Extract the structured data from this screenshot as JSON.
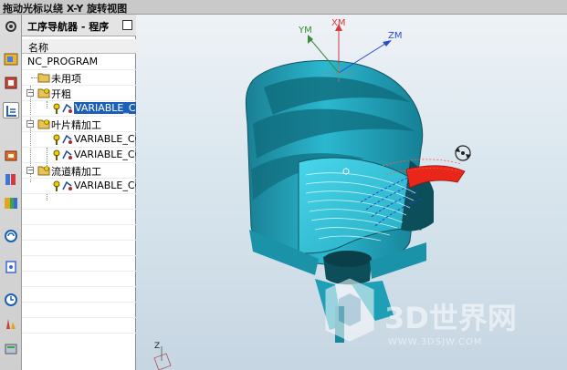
{
  "window": {
    "title": "拖动光标以绕 X-Y 旋转视图"
  },
  "navigator": {
    "title": "工序导航器 - 程序",
    "column_header": "名称",
    "items": [
      {
        "label": "NC_PROGRAM",
        "level": 0,
        "type": "root"
      },
      {
        "label": "未用项",
        "level": 1,
        "type": "group"
      },
      {
        "label": "开粗",
        "level": 1,
        "type": "group",
        "expanded": true
      },
      {
        "label": "VARIABLE_CO",
        "level": 2,
        "type": "operation",
        "selected": true
      },
      {
        "label": "叶片精加工",
        "level": 1,
        "type": "group",
        "expanded": true
      },
      {
        "label": "VARIABLE_CC",
        "level": 2,
        "type": "operation"
      },
      {
        "label": "VARIABLE_CC",
        "level": 2,
        "type": "operation"
      },
      {
        "label": "流道精加工",
        "level": 1,
        "type": "group",
        "expanded": true
      },
      {
        "label": "VARIABLE_CC",
        "level": 2,
        "type": "operation"
      }
    ]
  },
  "left_toolbar": {
    "icons": [
      "gear-icon",
      "assembly-icon",
      "part-icon",
      "operation-nav-icon",
      "machine-icon",
      "reuse-library-icon",
      "history-icon",
      "web-browser-icon",
      "palette-icon",
      "clock-icon",
      "roles-icon",
      "system-icon"
    ]
  },
  "viewport": {
    "axes": {
      "x": "XM",
      "y": "YM",
      "z": "ZM"
    },
    "triad_label": "Z",
    "watermark": {
      "brand": "3D世界网",
      "url": "WWW.3DSJW.COM"
    },
    "colors": {
      "part": "#28b0c7",
      "part_dark": "#16788a",
      "toolpath": "#e8261a",
      "background": "#d9e6ee"
    }
  }
}
